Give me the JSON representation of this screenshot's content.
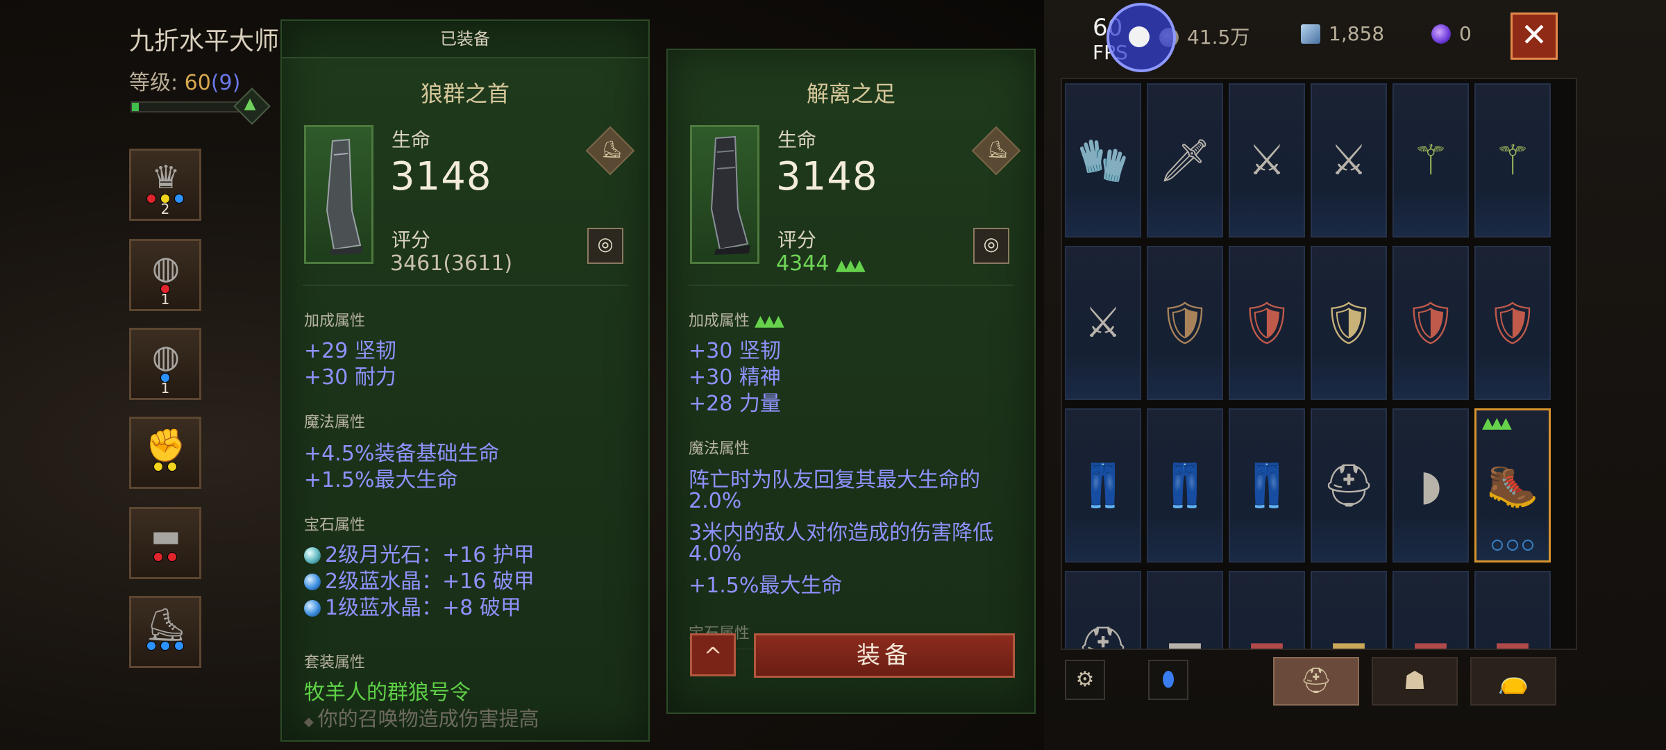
{
  "character": {
    "name": "九折水平大师",
    "level_label": "等级:",
    "level": "60",
    "paragon": "(9)",
    "xp_fraction": 0.06,
    "slots": [
      {
        "name": "crown-of-gems",
        "count": "2",
        "gems": [
          "red",
          "yellow",
          "blue"
        ]
      },
      {
        "name": "ring",
        "count": "1",
        "gems": [
          "red"
        ]
      },
      {
        "name": "ring",
        "count": "1",
        "gems": [
          "blue"
        ]
      },
      {
        "name": "gauntlet",
        "count": "",
        "gems": [
          "yellow",
          "yellow"
        ]
      },
      {
        "name": "belt",
        "count": "",
        "gems": [
          "red",
          "red"
        ]
      },
      {
        "name": "boots",
        "count": "",
        "gems": [
          "blue",
          "blue",
          "blue"
        ]
      }
    ]
  },
  "equipped": {
    "tab": "已装备",
    "name": "狼群之首",
    "life_label": "生命",
    "life_value": "3148",
    "score_label": "评分",
    "score_value": "3461(3611)",
    "bonus_title": "加成属性",
    "bonus": [
      "+29 坚韧",
      "+30 耐力"
    ],
    "magic_title": "魔法属性",
    "magic": [
      "+4.5%装备基础生命",
      "+1.5%最大生命"
    ],
    "gem_title": "宝石属性",
    "gems": [
      {
        "icon": "moonstone",
        "text": "2级月光石：+16 护甲"
      },
      {
        "icon": "sapphire",
        "text": "2级蓝水晶：+16 破甲"
      },
      {
        "icon": "sapphire",
        "text": "1级蓝水晶：+8 破甲"
      }
    ],
    "set_title": "套装属性",
    "set_name": "牧羊人的群狼号令",
    "set_bonus": "你的召唤物造成伤害提高"
  },
  "compare": {
    "name": "解离之足",
    "life_label": "生命",
    "life_value": "3148",
    "score_label": "评分",
    "score_value": "4344",
    "bonus_title": "加成属性",
    "bonus": [
      "+30 坚韧",
      "+30 精神",
      "+28 力量"
    ],
    "magic_title": "魔法属性",
    "magic": [
      "阵亡时为队友回复其最大生命的",
      "2.0%",
      "3米内的敌人对你造成的伤害降低",
      "4.0%",
      "+1.5%最大生命"
    ],
    "gem_title": "宝石属性",
    "up_icon": "^",
    "equip_label": "装备"
  },
  "topbar": {
    "fps_value": "60",
    "fps_label": "FPS",
    "gold": "41.5万",
    "crystal": "1,858",
    "orbs": "0",
    "close": "✕"
  },
  "inventory": {
    "tabs_left": [
      "settings-gear",
      "sapphire-orb"
    ],
    "categories": [
      "helmet",
      "armor-piece",
      "bag"
    ],
    "rows": [
      [
        "gauntlet-gold",
        "gauntlet-blade",
        "serrated-sword",
        "serrated-sword",
        "jade-staff",
        "jade-staff"
      ],
      [
        "serrated-sword",
        "bronze-chest",
        "red-chest",
        "gold-chest",
        "red-chest",
        "red-chest"
      ],
      [
        "leather-pants",
        "cloth-pants",
        "leather-pants",
        "spiked-helm",
        "pauldron",
        "boots"
      ],
      [
        "dark-helm",
        "leather-belt",
        "red-belt",
        "gold-belt",
        "red-belt",
        "red-belt"
      ]
    ]
  },
  "colors": {
    "accent_green": "#66d24c",
    "attr_blue": "#8f92ff",
    "panel_green": "#1f3a1c",
    "selection_orange": "#d7942e"
  }
}
